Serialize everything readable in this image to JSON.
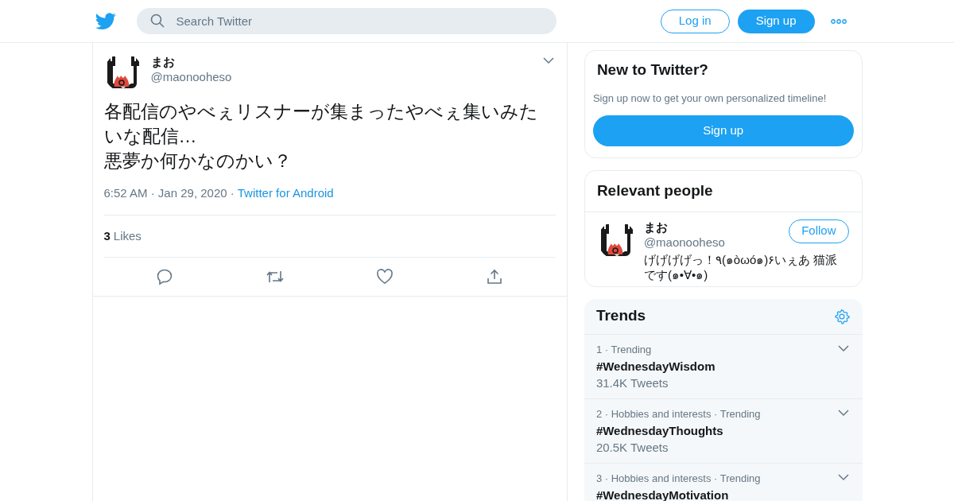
{
  "header": {
    "search": {
      "placeholder": "Search Twitter"
    },
    "buttons": [
      {
        "label": "Log in",
        "kind": "outline"
      },
      {
        "label": "Sign up",
        "kind": "filled"
      }
    ]
  },
  "tweet": {
    "name": "まお",
    "handle": "@maonooheso",
    "text": "各配信のやべぇリスナーが集まったやべぇ集いみたいな配信…\n悪夢か何かなのかい？",
    "timestamp": "6:52 AM · Jan 29, 2020 ·",
    "source": "Twitter for Android",
    "likes_count": "3",
    "likes_label": "Likes"
  },
  "signup_card": {
    "title": "New to Twitter?",
    "subtitle": "Sign up now to get your own personalized timeline!",
    "button": "Sign up"
  },
  "relevant_people": {
    "title": "Relevant people",
    "people": [
      {
        "name": "まお",
        "handle": "@maonooheso",
        "bio": "げげげげっ！٩(๑òωó๑)۶いぇあ 猫派です(๑•∀•๑)",
        "follow": "Follow"
      }
    ]
  },
  "trends": {
    "title": "Trends",
    "items": [
      {
        "meta": "1 · Trending",
        "name": "#WednesdayWisdom",
        "count": "31.4K Tweets"
      },
      {
        "meta": "2 · Hobbies and interests · Trending",
        "name": "#WednesdayThoughts",
        "count": "20.5K Tweets"
      },
      {
        "meta": "3 · Hobbies and interests · Trending",
        "name": "#WednesdayMotivation"
      }
    ]
  }
}
